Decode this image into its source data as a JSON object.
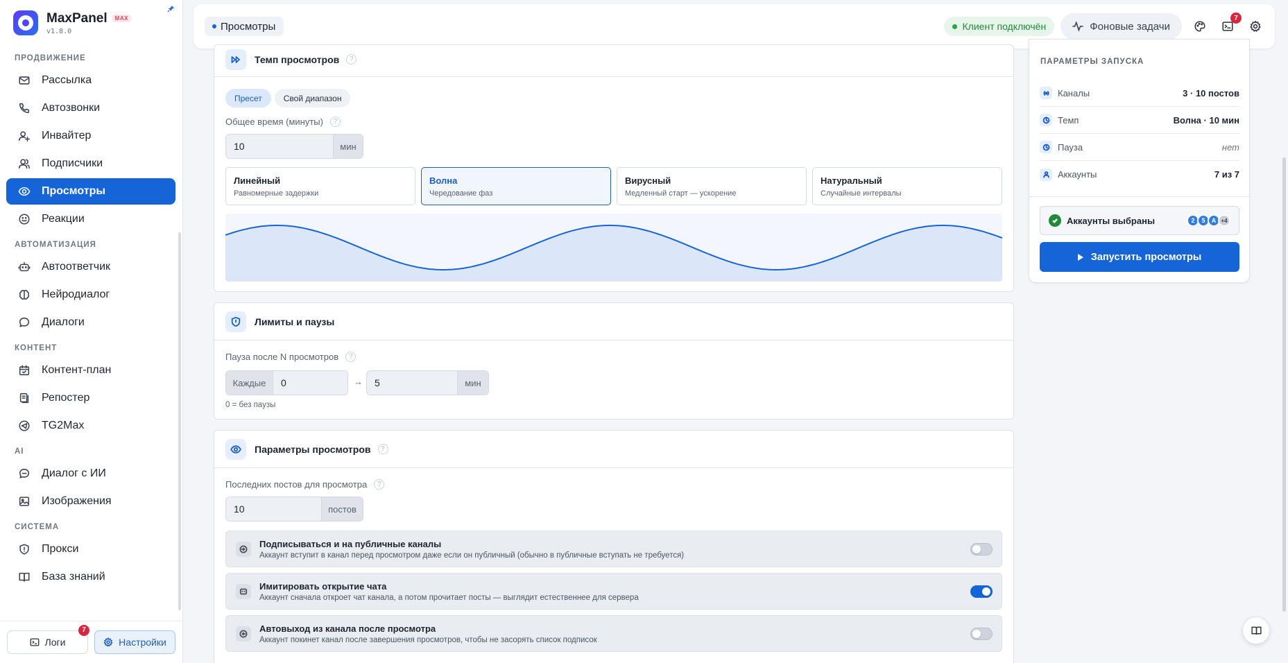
{
  "brand": {
    "name": "MaxPanel",
    "badge": "MAX",
    "version": "v1.8.0"
  },
  "sidebar": {
    "groups": [
      {
        "label": "ПРОДВИЖЕНИЕ"
      },
      {
        "label": "АВТОМАТИЗАЦИЯ"
      },
      {
        "label": "КОНТЕНТ"
      },
      {
        "label": "AI"
      },
      {
        "label": "СИСТЕМА"
      }
    ],
    "items": [
      {
        "label": "Рассылка",
        "icon": "mail-icon"
      },
      {
        "label": "Автозвонки",
        "icon": "phone-icon"
      },
      {
        "label": "Инвайтер",
        "icon": "user-plus-icon"
      },
      {
        "label": "Подписчики",
        "icon": "users-icon"
      },
      {
        "label": "Просмотры",
        "icon": "eye-icon",
        "active": true
      },
      {
        "label": "Реакции",
        "icon": "smile-icon"
      },
      {
        "label": "Автоответчик",
        "icon": "bot-icon"
      },
      {
        "label": "Нейродиалог",
        "icon": "brain-icon"
      },
      {
        "label": "Диалоги",
        "icon": "chat-icon"
      },
      {
        "label": "Контент-план",
        "icon": "calendar-icon"
      },
      {
        "label": "Репостер",
        "icon": "copy-icon"
      },
      {
        "label": "TG2Max",
        "icon": "send-icon"
      },
      {
        "label": "Диалог с ИИ",
        "icon": "ai-chat-icon"
      },
      {
        "label": "Изображения",
        "icon": "image-icon"
      },
      {
        "label": "Прокси",
        "icon": "shield-icon"
      },
      {
        "label": "База знаний",
        "icon": "book-icon"
      }
    ],
    "logs_label": "Логи",
    "logs_badge": "7",
    "settings_label": "Настройки"
  },
  "header": {
    "breadcrumb": "Просмотры",
    "status": "Клиент подключён",
    "tasks_label": "Фоновые задачи",
    "terminal_badge": "7"
  },
  "tempo": {
    "title": "Темп просмотров",
    "modes": [
      "Пресет",
      "Свой диапазон"
    ],
    "total_time_label": "Общее время (минуты)",
    "total_time_value": "10",
    "total_time_unit": "мин",
    "presets": [
      {
        "title": "Линейный",
        "desc": "Равномерные задержки"
      },
      {
        "title": "Волна",
        "desc": "Чередование фаз",
        "active": true
      },
      {
        "title": "Вирусный",
        "desc": "Медленный старт — ускорение"
      },
      {
        "title": "Натуральный",
        "desc": "Случайные интервалы"
      }
    ],
    "wave_color": "#1565d8"
  },
  "limits": {
    "title": "Лимиты и паузы",
    "pause_label": "Пауза после N просмотров",
    "every_label": "Каждые",
    "every_value": "0",
    "arrow": "→",
    "pause_value": "5",
    "pause_unit": "мин",
    "hint": "0 = без паузы"
  },
  "params": {
    "title": "Параметры просмотров",
    "last_posts_label": "Последних постов для просмотра",
    "last_posts_value": "10",
    "last_posts_unit": "постов",
    "toggles": [
      {
        "title": "Подписываться и на публичные каналы",
        "desc": "Аккаунт вступит в канал перед просмотром даже если он публичный (обычно в публичные вступать не требуется)",
        "on": false,
        "icon": "login-icon"
      },
      {
        "title": "Имитировать открытие чата",
        "desc": "Аккаунт сначала откроет чат канала, а потом прочитает посты — выглядит естественнее для сервера",
        "on": true,
        "icon": "bot-face-icon"
      },
      {
        "title": "Автовыход из канала после просмотра",
        "desc": "Аккаунт покинет канал после завершения просмотров, чтобы не засорять список подписок",
        "on": false,
        "icon": "logout-icon"
      }
    ]
  },
  "launch": {
    "title": "ПАРАМЕТРЫ ЗАПУСКА",
    "rows": [
      {
        "label": "Каналы",
        "value": "3 · 10 постов",
        "icon": "antenna-icon"
      },
      {
        "label": "Темп",
        "value": "Волна · 10 мин",
        "icon": "clock-icon"
      },
      {
        "label": "Пауза",
        "value": "нет",
        "icon": "clock-icon",
        "muted": true
      },
      {
        "label": "Аккаунты",
        "value": "7 из 7",
        "icon": "user-icon"
      }
    ],
    "accounts_title": "Аккаунты выбраны",
    "avatars": [
      "2",
      "5",
      "A",
      "+4"
    ],
    "button": "Запустить просмотры"
  }
}
